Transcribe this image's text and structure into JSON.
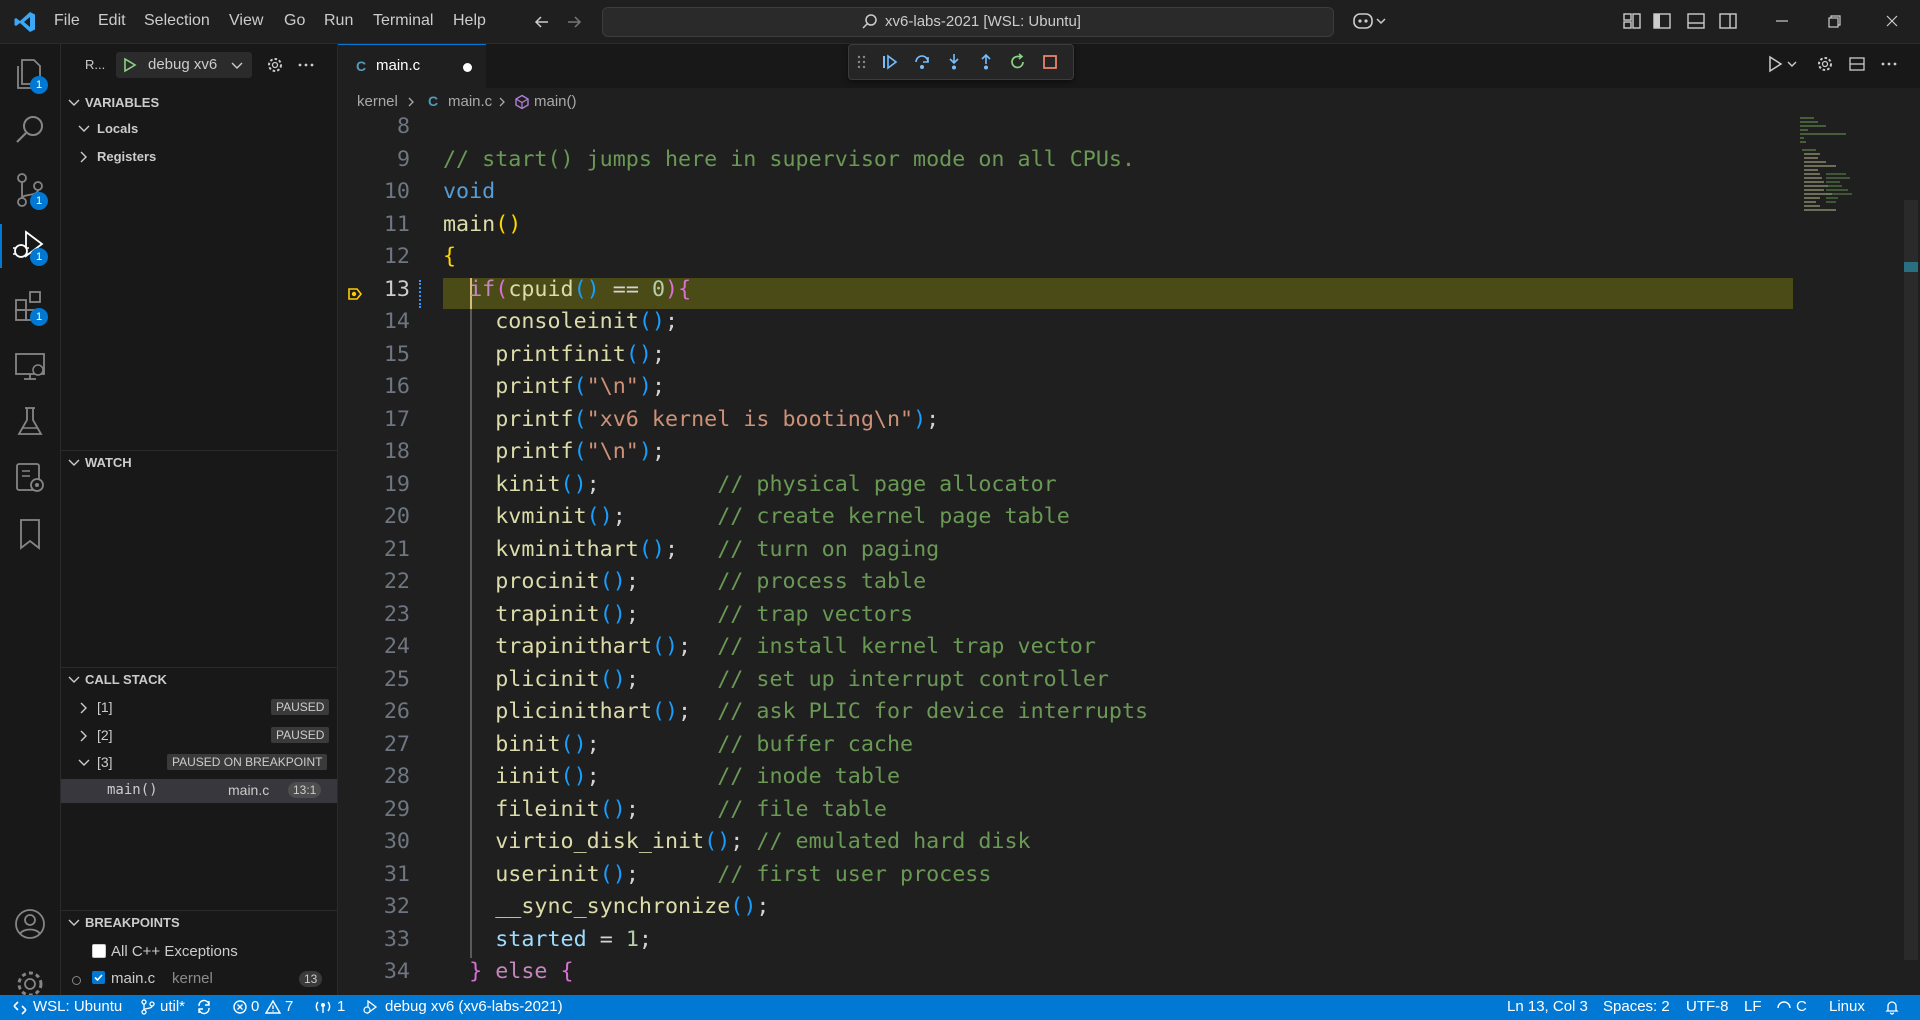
{
  "menu": [
    "File",
    "Edit",
    "Selection",
    "View",
    "Go",
    "Run",
    "Terminal",
    "Help"
  ],
  "command_center": "xv6-labs-2021 [WSL: Ubuntu]",
  "activity_badges": {
    "explorer": "1",
    "scm": "1",
    "debug": "1",
    "extensions": "1"
  },
  "sidebar": {
    "run_label": "R...",
    "config": "debug xv6",
    "variables_title": "VARIABLES",
    "locals": "Locals",
    "registers": "Registers",
    "watch_title": "WATCH",
    "callstack_title": "CALL STACK",
    "threads": [
      {
        "id": "[1]",
        "state": "PAUSED"
      },
      {
        "id": "[2]",
        "state": "PAUSED"
      },
      {
        "id": "[3]",
        "state": "PAUSED ON BREAKPOINT"
      }
    ],
    "frame": {
      "name": "main()",
      "file": "main.c",
      "pos": "13:1"
    },
    "breakpoints_title": "BREAKPOINTS",
    "bp_exceptions": "All C++ Exceptions",
    "bp_file": "main.c",
    "bp_dir": "kernel",
    "bp_line": "13"
  },
  "editor": {
    "tab_label": "main.c",
    "breadcrumb": {
      "folder": "kernel",
      "file": "main.c",
      "symbol": "main()"
    },
    "line_numbers": [
      "8",
      "9",
      "10",
      "11",
      "12",
      "13",
      "14",
      "15",
      "16",
      "17",
      "18",
      "19",
      "20",
      "21",
      "22",
      "23",
      "24",
      "25",
      "26",
      "27",
      "28",
      "29",
      "30",
      "31",
      "32",
      "33",
      "34"
    ],
    "lines": [
      {
        "segs": []
      },
      {
        "segs": [
          {
            "t": "// start() jumps here in supervisor mode on all CPUs.",
            "c": "c-com"
          }
        ]
      },
      {
        "segs": [
          {
            "t": "void",
            "c": "c-kw"
          }
        ]
      },
      {
        "segs": [
          {
            "t": "main",
            "c": "c-fn"
          },
          {
            "t": "()",
            "c": "c-p1"
          }
        ]
      },
      {
        "segs": [
          {
            "t": "{",
            "c": "c-p1"
          }
        ]
      },
      {
        "segs": [
          {
            "t": "  ",
            "c": "c-op"
          },
          {
            "t": "if",
            "c": "c-kw2"
          },
          {
            "t": "(",
            "c": "c-p2"
          },
          {
            "t": "cpuid",
            "c": "c-fn"
          },
          {
            "t": "()",
            "c": "c-p3"
          },
          {
            "t": " == ",
            "c": "c-op"
          },
          {
            "t": "0",
            "c": "c-num"
          },
          {
            "t": "){",
            "c": "c-p2"
          }
        ]
      },
      {
        "segs": [
          {
            "t": "    consoleinit",
            "c": "c-fn"
          },
          {
            "t": "()",
            "c": "c-p3"
          },
          {
            "t": ";",
            "c": "c-op"
          }
        ]
      },
      {
        "segs": [
          {
            "t": "    printfinit",
            "c": "c-fn"
          },
          {
            "t": "()",
            "c": "c-p3"
          },
          {
            "t": ";",
            "c": "c-op"
          }
        ]
      },
      {
        "segs": [
          {
            "t": "    printf",
            "c": "c-fn"
          },
          {
            "t": "(",
            "c": "c-p3"
          },
          {
            "t": "\"\\n\"",
            "c": "c-str"
          },
          {
            "t": ")",
            "c": "c-p3"
          },
          {
            "t": ";",
            "c": "c-op"
          }
        ]
      },
      {
        "segs": [
          {
            "t": "    printf",
            "c": "c-fn"
          },
          {
            "t": "(",
            "c": "c-p3"
          },
          {
            "t": "\"xv6 kernel is booting\\n\"",
            "c": "c-str"
          },
          {
            "t": ")",
            "c": "c-p3"
          },
          {
            "t": ";",
            "c": "c-op"
          }
        ]
      },
      {
        "segs": [
          {
            "t": "    printf",
            "c": "c-fn"
          },
          {
            "t": "(",
            "c": "c-p3"
          },
          {
            "t": "\"\\n\"",
            "c": "c-str"
          },
          {
            "t": ")",
            "c": "c-p3"
          },
          {
            "t": ";",
            "c": "c-op"
          }
        ]
      },
      {
        "segs": [
          {
            "t": "    kinit",
            "c": "c-fn"
          },
          {
            "t": "()",
            "c": "c-p3"
          },
          {
            "t": ";         ",
            "c": "c-op"
          },
          {
            "t": "// physical page allocator",
            "c": "c-com"
          }
        ]
      },
      {
        "segs": [
          {
            "t": "    kvminit",
            "c": "c-fn"
          },
          {
            "t": "()",
            "c": "c-p3"
          },
          {
            "t": ";       ",
            "c": "c-op"
          },
          {
            "t": "// create kernel page table",
            "c": "c-com"
          }
        ]
      },
      {
        "segs": [
          {
            "t": "    kvminithart",
            "c": "c-fn"
          },
          {
            "t": "()",
            "c": "c-p3"
          },
          {
            "t": ";   ",
            "c": "c-op"
          },
          {
            "t": "// turn on paging",
            "c": "c-com"
          }
        ]
      },
      {
        "segs": [
          {
            "t": "    procinit",
            "c": "c-fn"
          },
          {
            "t": "()",
            "c": "c-p3"
          },
          {
            "t": ";      ",
            "c": "c-op"
          },
          {
            "t": "// process table",
            "c": "c-com"
          }
        ]
      },
      {
        "segs": [
          {
            "t": "    trapinit",
            "c": "c-fn"
          },
          {
            "t": "()",
            "c": "c-p3"
          },
          {
            "t": ";      ",
            "c": "c-op"
          },
          {
            "t": "// trap vectors",
            "c": "c-com"
          }
        ]
      },
      {
        "segs": [
          {
            "t": "    trapinithart",
            "c": "c-fn"
          },
          {
            "t": "()",
            "c": "c-p3"
          },
          {
            "t": ";  ",
            "c": "c-op"
          },
          {
            "t": "// install kernel trap vector",
            "c": "c-com"
          }
        ]
      },
      {
        "segs": [
          {
            "t": "    plicinit",
            "c": "c-fn"
          },
          {
            "t": "()",
            "c": "c-p3"
          },
          {
            "t": ";      ",
            "c": "c-op"
          },
          {
            "t": "// set up interrupt controller",
            "c": "c-com"
          }
        ]
      },
      {
        "segs": [
          {
            "t": "    plicinithart",
            "c": "c-fn"
          },
          {
            "t": "()",
            "c": "c-p3"
          },
          {
            "t": ";  ",
            "c": "c-op"
          },
          {
            "t": "// ask PLIC for device interrupts",
            "c": "c-com"
          }
        ]
      },
      {
        "segs": [
          {
            "t": "    binit",
            "c": "c-fn"
          },
          {
            "t": "()",
            "c": "c-p3"
          },
          {
            "t": ";         ",
            "c": "c-op"
          },
          {
            "t": "// buffer cache",
            "c": "c-com"
          }
        ]
      },
      {
        "segs": [
          {
            "t": "    iinit",
            "c": "c-fn"
          },
          {
            "t": "()",
            "c": "c-p3"
          },
          {
            "t": ";         ",
            "c": "c-op"
          },
          {
            "t": "// inode table",
            "c": "c-com"
          }
        ]
      },
      {
        "segs": [
          {
            "t": "    fileinit",
            "c": "c-fn"
          },
          {
            "t": "()",
            "c": "c-p3"
          },
          {
            "t": ";      ",
            "c": "c-op"
          },
          {
            "t": "// file table",
            "c": "c-com"
          }
        ]
      },
      {
        "segs": [
          {
            "t": "    virtio_disk_init",
            "c": "c-fn"
          },
          {
            "t": "()",
            "c": "c-p3"
          },
          {
            "t": "; ",
            "c": "c-op"
          },
          {
            "t": "// emulated hard disk",
            "c": "c-com"
          }
        ]
      },
      {
        "segs": [
          {
            "t": "    userinit",
            "c": "c-fn"
          },
          {
            "t": "()",
            "c": "c-p3"
          },
          {
            "t": ";      ",
            "c": "c-op"
          },
          {
            "t": "// first user process",
            "c": "c-com"
          }
        ]
      },
      {
        "segs": [
          {
            "t": "    __sync_synchronize",
            "c": "c-fn"
          },
          {
            "t": "()",
            "c": "c-p3"
          },
          {
            "t": ";",
            "c": "c-op"
          }
        ]
      },
      {
        "segs": [
          {
            "t": "    started",
            "c": "c-var"
          },
          {
            "t": " = ",
            "c": "c-op"
          },
          {
            "t": "1",
            "c": "c-num"
          },
          {
            "t": ";",
            "c": "c-op"
          }
        ]
      },
      {
        "segs": [
          {
            "t": "  ",
            "c": "c-op"
          },
          {
            "t": "}",
            "c": "c-p2"
          },
          {
            "t": " ",
            "c": "c-op"
          },
          {
            "t": "else",
            "c": "c-kw2"
          },
          {
            "t": " ",
            "c": "c-op"
          },
          {
            "t": "{",
            "c": "c-p2"
          }
        ]
      }
    ]
  },
  "status": {
    "remote": "WSL: Ubuntu",
    "branch": "util*",
    "errors": "0",
    "warnings": "7",
    "ports": "1",
    "debug": "debug xv6 (xv6-labs-2021)",
    "position": "Ln 13, Col 3",
    "spaces": "Spaces: 2",
    "encoding": "UTF-8",
    "eol": "LF",
    "language": "C",
    "platform": "Linux"
  },
  "colors": {
    "accent": "#0078d4",
    "current_line": "#4b4b18",
    "breakpoint": "#ffcc00"
  }
}
